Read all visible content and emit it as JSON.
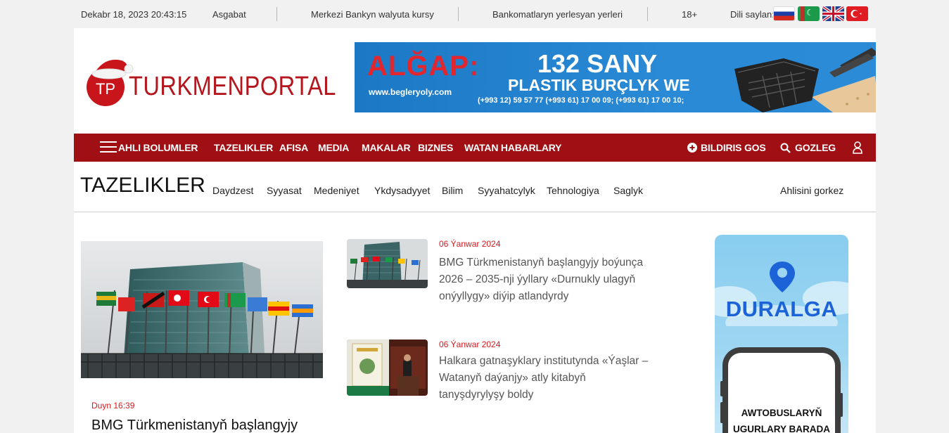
{
  "topbar": {
    "datetime": "Dekabr 18, 2023 20:43:15",
    "city": "Asgabat",
    "rates_link": "Merkezi Bankyn walyuta kursy",
    "atm_link": "Bankomatlaryn yerlesyan yerleri",
    "age": "18+",
    "lang_label": "Dili saylan:",
    "languages": [
      "Russian",
      "Turkmen",
      "English",
      "Turkish"
    ]
  },
  "header": {
    "logo_text": "TURKMENPORTAL",
    "logo_initials": "TP",
    "banner": {
      "brand": "ALĞAP:",
      "url": "www.begleryoly.com",
      "headline": "132 SANY",
      "subheadline": "PLASTIK BURÇLYK WE",
      "phones": "(+993 12) 59 57 77   (+993 61) 17 00 09; (+993 61) 17 00 10;"
    }
  },
  "nav": {
    "all_sections": "AHLI BOLUMLER",
    "items": [
      "TAZELIKLER",
      "AFISA",
      "MEDIA",
      "MAKALAR",
      "BIZNES",
      "WATAN HABARLARY"
    ],
    "announce": "BILDIRIS GOS",
    "search": "GOZLEG"
  },
  "section": {
    "title": "TAZELIKLER",
    "categories": [
      "Daydzest",
      "Syyasat",
      "Medeniyet",
      "Ykdysadyyet",
      "Bilim",
      "Syyahatcylyk",
      "Tehnologiya",
      "Saglyk"
    ],
    "more": "Ahlisini gorkez"
  },
  "lead": {
    "time": "Duyn 16:39",
    "title": "BMG Türkmenistanyň başlangyjy"
  },
  "news": [
    {
      "date": "06 Ýanwar 2024",
      "text": "BMG Türkmenistanyň başlangyjy boýunça 2026 – 2035-nji ýyllary «Durnukly ulagyň onýyllygy» diýip atlandyrdy"
    },
    {
      "date": "06 Ýanwar 2024",
      "text": "Halkara gatnaşyklary institutynda «Ýaşlar – Watanyň daýanjy» atly kitabyň tanyşdyrylyşy boldy"
    }
  ],
  "side_ad": {
    "word": "DURALGA",
    "line1": "AWTOBUSLARYŇ",
    "line2": "UGURLARY BARADA"
  }
}
